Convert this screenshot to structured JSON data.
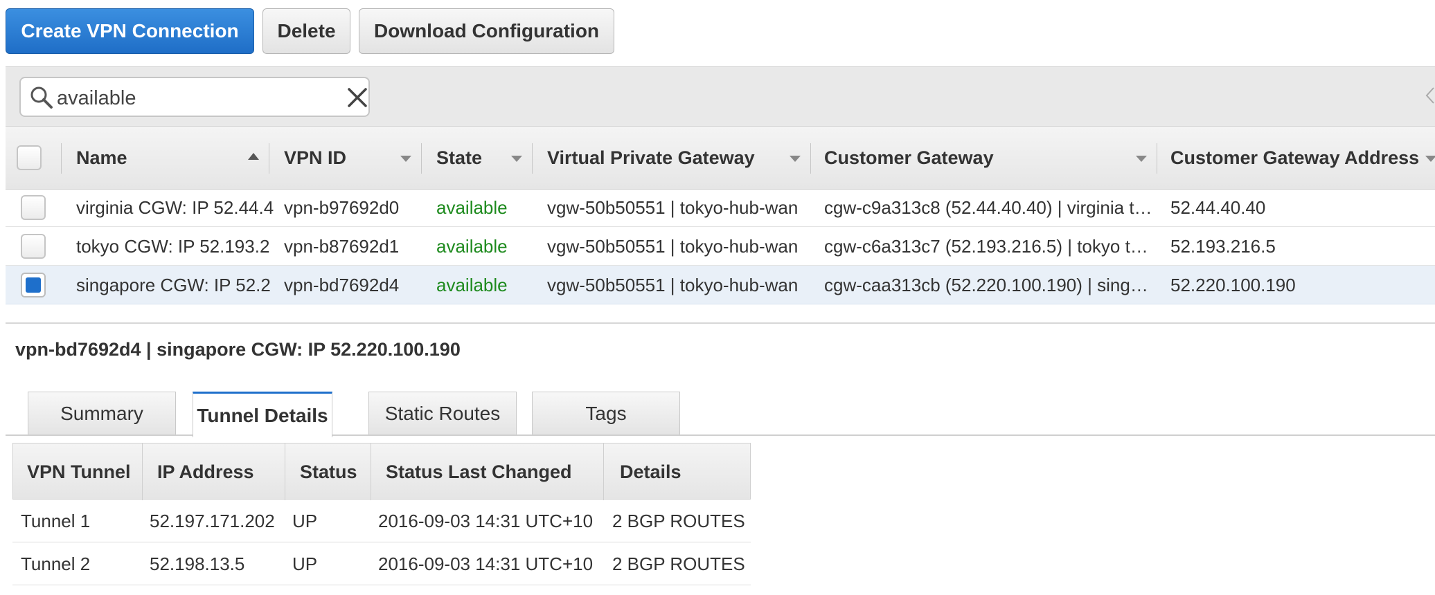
{
  "toolbar": {
    "create_label": "Create VPN Connection",
    "delete_label": "Delete",
    "download_label": "Download Configuration"
  },
  "search": {
    "value": "available"
  },
  "grid": {
    "columns": {
      "name": "Name",
      "vpn_id": "VPN ID",
      "state": "State",
      "vpg": "Virtual Private Gateway",
      "cgw": "Customer Gateway",
      "cgw_address": "Customer Gateway Address"
    },
    "rows": [
      {
        "name": "virginia CGW: IP 52.44.4",
        "vpn_id": "vpn-b97692d0",
        "state": "available",
        "vpg": "vgw-50b50551 | tokyo-hub-wan",
        "cgw": "cgw-c9a313c8 (52.44.40.40) | virginia t…",
        "cgw_address": "52.44.40.40",
        "selected": false
      },
      {
        "name": "tokyo CGW: IP 52.193.2",
        "vpn_id": "vpn-b87692d1",
        "state": "available",
        "vpg": "vgw-50b50551 | tokyo-hub-wan",
        "cgw": "cgw-c6a313c7 (52.193.216.5) | tokyo t…",
        "cgw_address": "52.193.216.5",
        "selected": false
      },
      {
        "name": "singapore CGW: IP 52.2",
        "vpn_id": "vpn-bd7692d4",
        "state": "available",
        "vpg": "vgw-50b50551 | tokyo-hub-wan",
        "cgw": "cgw-caa313cb (52.220.100.190) | sing…",
        "cgw_address": "52.220.100.190",
        "selected": true
      }
    ]
  },
  "detail": {
    "title": "vpn-bd7692d4 | singapore CGW: IP 52.220.100.190",
    "tabs": [
      "Summary",
      "Tunnel Details",
      "Static Routes",
      "Tags"
    ],
    "active_tab": "Tunnel Details"
  },
  "tunnels": {
    "columns": {
      "tunnel": "VPN Tunnel",
      "ip": "IP Address",
      "status": "Status",
      "changed": "Status Last Changed",
      "details": "Details"
    },
    "rows": [
      {
        "tunnel": "Tunnel 1",
        "ip": "52.197.171.202",
        "status": "UP",
        "changed": "2016-09-03 14:31 UTC+10",
        "details": "2 BGP ROUTES"
      },
      {
        "tunnel": "Tunnel 2",
        "ip": "52.198.13.5",
        "status": "UP",
        "changed": "2016-09-03 14:31 UTC+10",
        "details": "2 BGP ROUTES"
      }
    ]
  },
  "colors": {
    "primary": "#1f6ec7",
    "state_available": "#1d8a1d",
    "selected_row": "#e9f0f8"
  },
  "icons": [
    "search-icon",
    "clear-icon",
    "collapse-icon",
    "sort-asc-icon",
    "sort-desc-icon"
  ]
}
